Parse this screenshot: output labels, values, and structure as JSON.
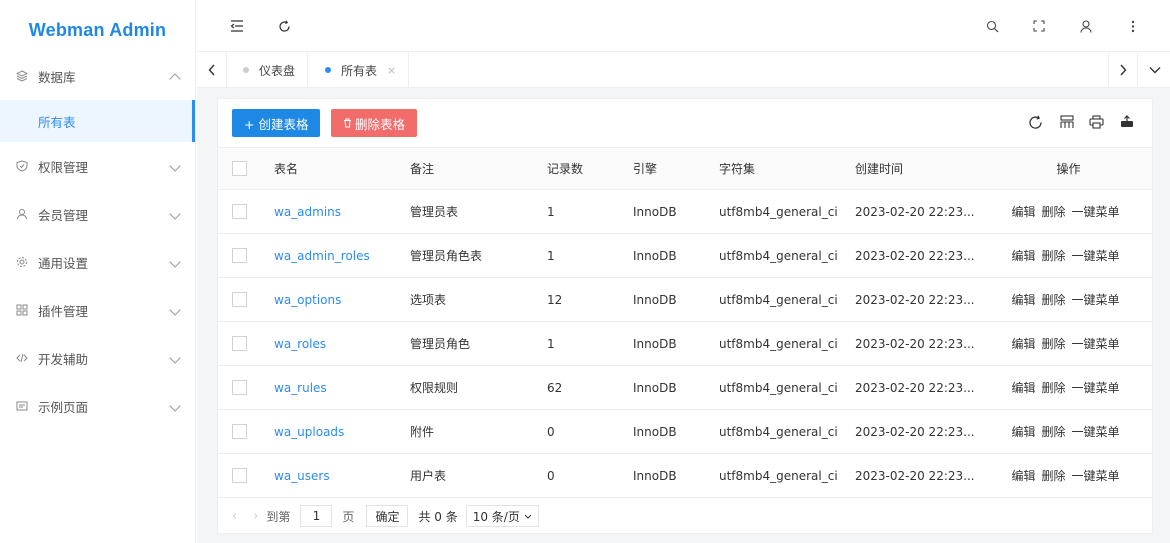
{
  "brand": "Webman Admin",
  "colors": {
    "accent": "#1e88e5",
    "danger": "#f26c6c",
    "link": "#2d8cf0"
  },
  "sidebar": {
    "items": [
      {
        "label": "数据库",
        "icon": "layers-icon",
        "expanded": true
      },
      {
        "label": "权限管理",
        "icon": "shield-icon"
      },
      {
        "label": "会员管理",
        "icon": "user-icon"
      },
      {
        "label": "通用设置",
        "icon": "gear-icon"
      },
      {
        "label": "插件管理",
        "icon": "plugin-icon"
      },
      {
        "label": "开发辅助",
        "icon": "code-icon"
      },
      {
        "label": "示例页面",
        "icon": "page-icon"
      }
    ],
    "subitem": {
      "label": "所有表"
    }
  },
  "header": {
    "icons": [
      "menu-fold-icon",
      "refresh-icon",
      "search-icon",
      "fullscreen-icon",
      "user-icon",
      "more-icon"
    ]
  },
  "tabs": [
    {
      "label": "仪表盘",
      "active": false
    },
    {
      "label": "所有表",
      "active": true,
      "close": "×"
    }
  ],
  "toolbar": {
    "create_label": "+ 创建表格",
    "delete_label": "删除表格",
    "delete_icon": "trash-icon"
  },
  "table": {
    "headers": [
      "表名",
      "备注",
      "记录数",
      "引擎",
      "字符集",
      "创建时间",
      "操作"
    ],
    "rows": [
      {
        "name": "wa_admins",
        "remark": "管理员表",
        "count": "1",
        "engine": "InnoDB",
        "charset": "utf8mb4_general_ci",
        "created": "2023-02-20 22:23..."
      },
      {
        "name": "wa_admin_roles",
        "remark": "管理员角色表",
        "count": "1",
        "engine": "InnoDB",
        "charset": "utf8mb4_general_ci",
        "created": "2023-02-20 22:23..."
      },
      {
        "name": "wa_options",
        "remark": "选项表",
        "count": "12",
        "engine": "InnoDB",
        "charset": "utf8mb4_general_ci",
        "created": "2023-02-20 22:23..."
      },
      {
        "name": "wa_roles",
        "remark": "管理员角色",
        "count": "1",
        "engine": "InnoDB",
        "charset": "utf8mb4_general_ci",
        "created": "2023-02-20 22:23..."
      },
      {
        "name": "wa_rules",
        "remark": "权限规则",
        "count": "62",
        "engine": "InnoDB",
        "charset": "utf8mb4_general_ci",
        "created": "2023-02-20 22:23..."
      },
      {
        "name": "wa_uploads",
        "remark": "附件",
        "count": "0",
        "engine": "InnoDB",
        "charset": "utf8mb4_general_ci",
        "created": "2023-02-20 22:23..."
      },
      {
        "name": "wa_users",
        "remark": "用户表",
        "count": "0",
        "engine": "InnoDB",
        "charset": "utf8mb4_general_ci",
        "created": "2023-02-20 22:23..."
      }
    ],
    "ops": [
      "编辑",
      "删除",
      "一键菜单"
    ]
  },
  "pager": {
    "goto_label": "到第",
    "page_value": "1",
    "page_unit": "页",
    "confirm": "确定",
    "total": "共 0 条",
    "per_page": "10 条/页"
  }
}
